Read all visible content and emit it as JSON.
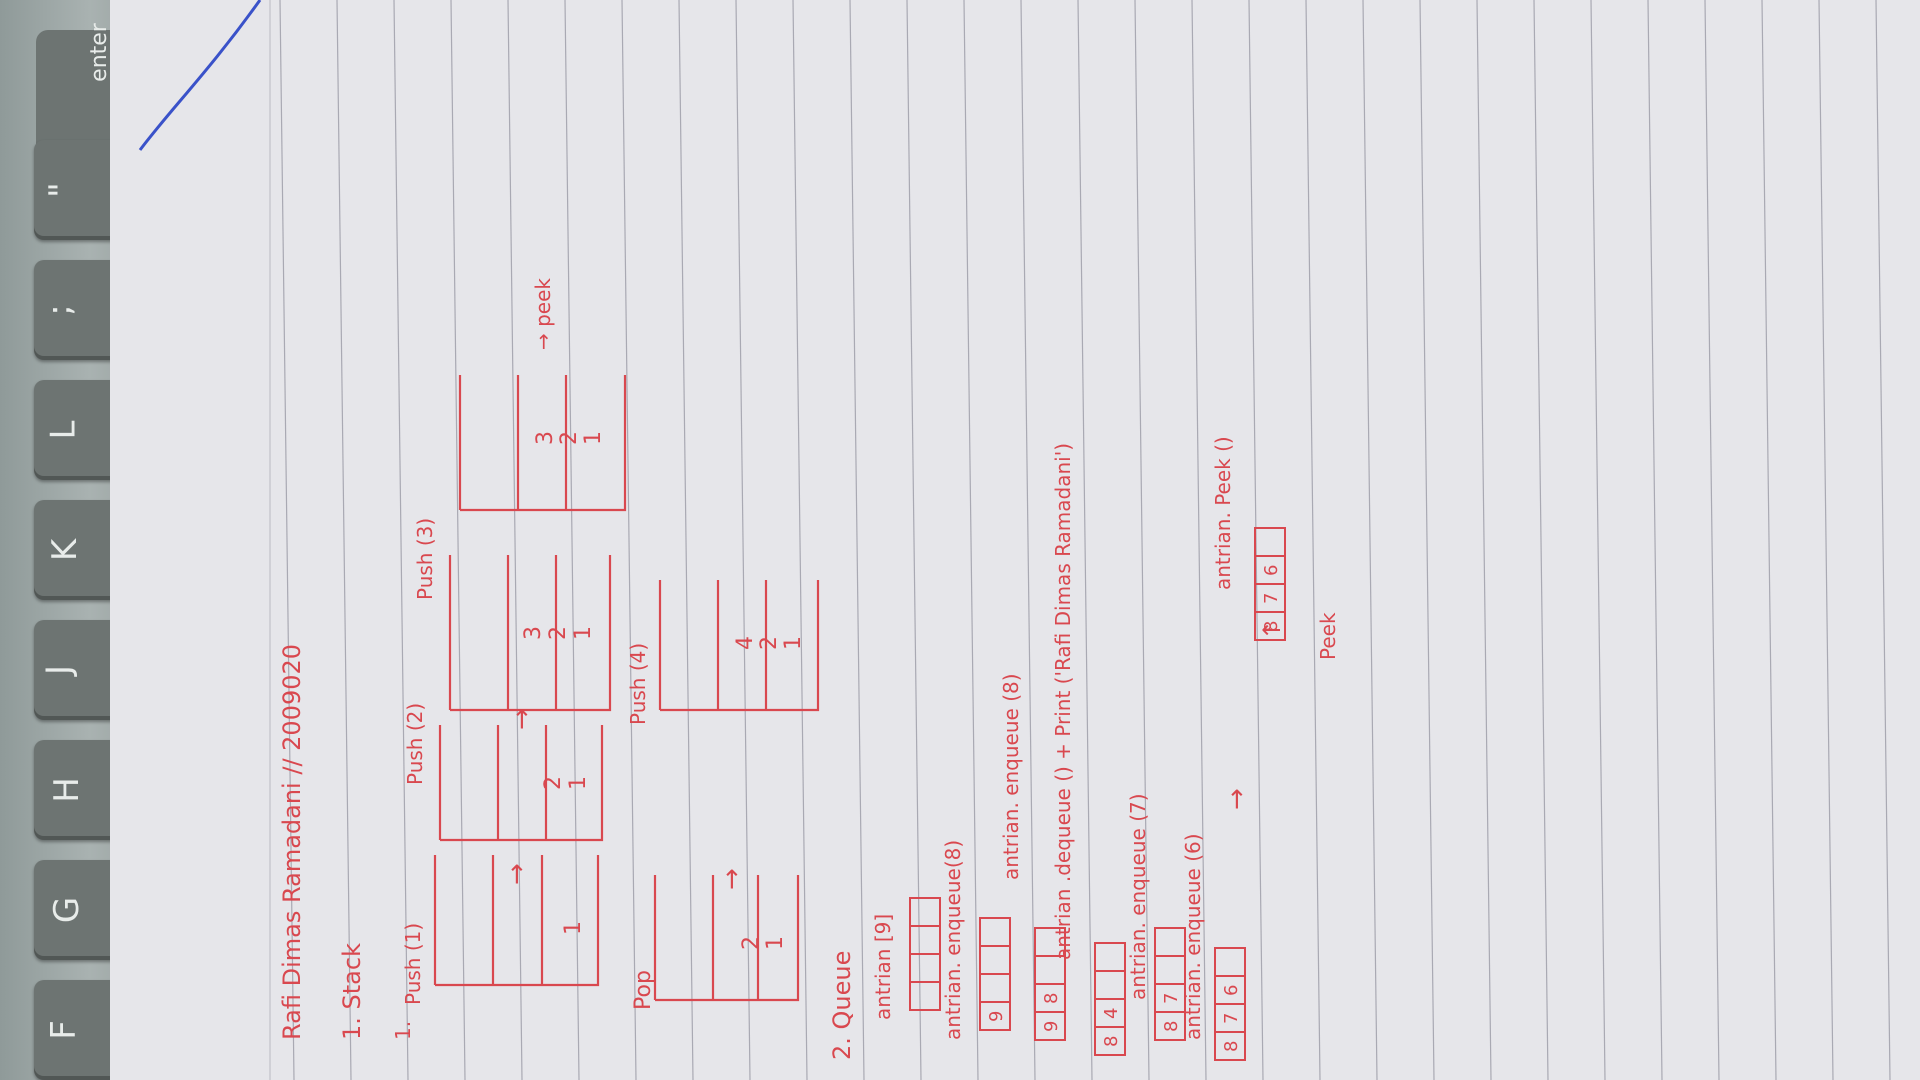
{
  "keyboard": {
    "keys": [
      "F",
      "G",
      "H",
      "J",
      "K",
      "L",
      ";",
      "\""
    ],
    "enter_label": "enter"
  },
  "note": {
    "header": "Rafi Dimas Ramadani // 2009020",
    "section_stack": "1. Stack",
    "step_number": "1.",
    "push1": "Push (1)",
    "push2": "Push (2)",
    "push3": "Push (3)",
    "push4": "Push (4)",
    "pop": "Pop",
    "peek_label": "→ peek",
    "section_queue": "2. Queue",
    "q1": "antrian [9]",
    "q2": "antrian. enqueue(8)",
    "q3": "antrian. enqueue (8)",
    "q4": "antrian .dequeue () + Print ('Rafi Dimas Ramadani')",
    "q5": "antrian. enqueue (7)",
    "q6": "antrian. enqueue (6)",
    "q7": "antrian. Peek ()",
    "peek_word": "Peek",
    "stack_values": {
      "s1": [
        "1"
      ],
      "s2": [
        "1",
        "2"
      ],
      "s3": [
        "1",
        "2",
        "3"
      ],
      "s3b": [
        "1",
        "2",
        "3"
      ],
      "pop": [
        "1",
        "2"
      ],
      "s4": [
        "1",
        "2",
        "4"
      ]
    },
    "queue_cells": {
      "q1": [
        "",
        "",
        "",
        ""
      ],
      "q2": [
        "9",
        "",
        "",
        ""
      ],
      "q3": [
        "9",
        "8",
        "",
        ""
      ],
      "q4": [
        "8",
        "4",
        "",
        ""
      ],
      "q5": [
        "8",
        "7",
        "",
        ""
      ],
      "q6": [
        "8",
        "7",
        "6",
        ""
      ],
      "q7": [
        "8",
        "7",
        "6",
        ""
      ]
    },
    "arrow": "→",
    "ink_color": "#d9484f"
  }
}
